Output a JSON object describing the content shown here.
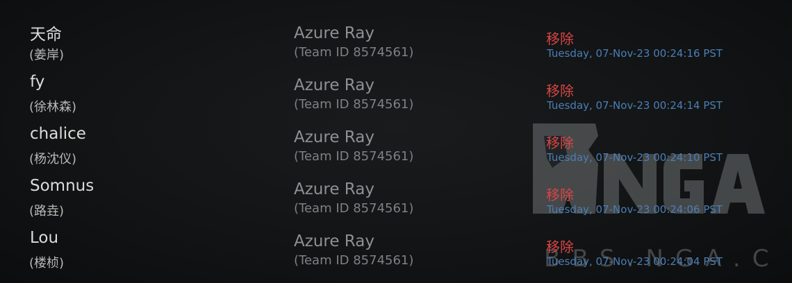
{
  "watermark": {
    "logo_text": "NGA",
    "site_text": "BBS.NGA.CN",
    "color": "#6f7275"
  },
  "colors": {
    "remove": "#d84545",
    "timestamp": "#4b7fb6"
  },
  "rows": [
    {
      "name": "天命",
      "real_name": "(姜岸)",
      "team": "Azure Ray",
      "team_id": "(Team ID 8574561)",
      "action": "移除",
      "timestamp": "Tuesday, 07-Nov-23 00:24:16 PST"
    },
    {
      "name": "fy",
      "real_name": "(徐林森)",
      "team": "Azure Ray",
      "team_id": "(Team ID 8574561)",
      "action": "移除",
      "timestamp": "Tuesday, 07-Nov-23 00:24:14 PST"
    },
    {
      "name": "chalice",
      "real_name": "(杨沈仪)",
      "team": "Azure Ray",
      "team_id": "(Team ID 8574561)",
      "action": "移除",
      "timestamp": "Tuesday, 07-Nov-23 00:24:10 PST"
    },
    {
      "name": "Somnus",
      "real_name": "(路垚)",
      "team": "Azure Ray",
      "team_id": "(Team ID 8574561)",
      "action": "移除",
      "timestamp": "Tuesday, 07-Nov-23 00:24:06 PST"
    },
    {
      "name": "Lou",
      "real_name": "(楼桢)",
      "team": "Azure Ray",
      "team_id": "(Team ID 8574561)",
      "action": "移除",
      "timestamp": "Tuesday, 07-Nov-23 00:24:04 PST"
    }
  ]
}
